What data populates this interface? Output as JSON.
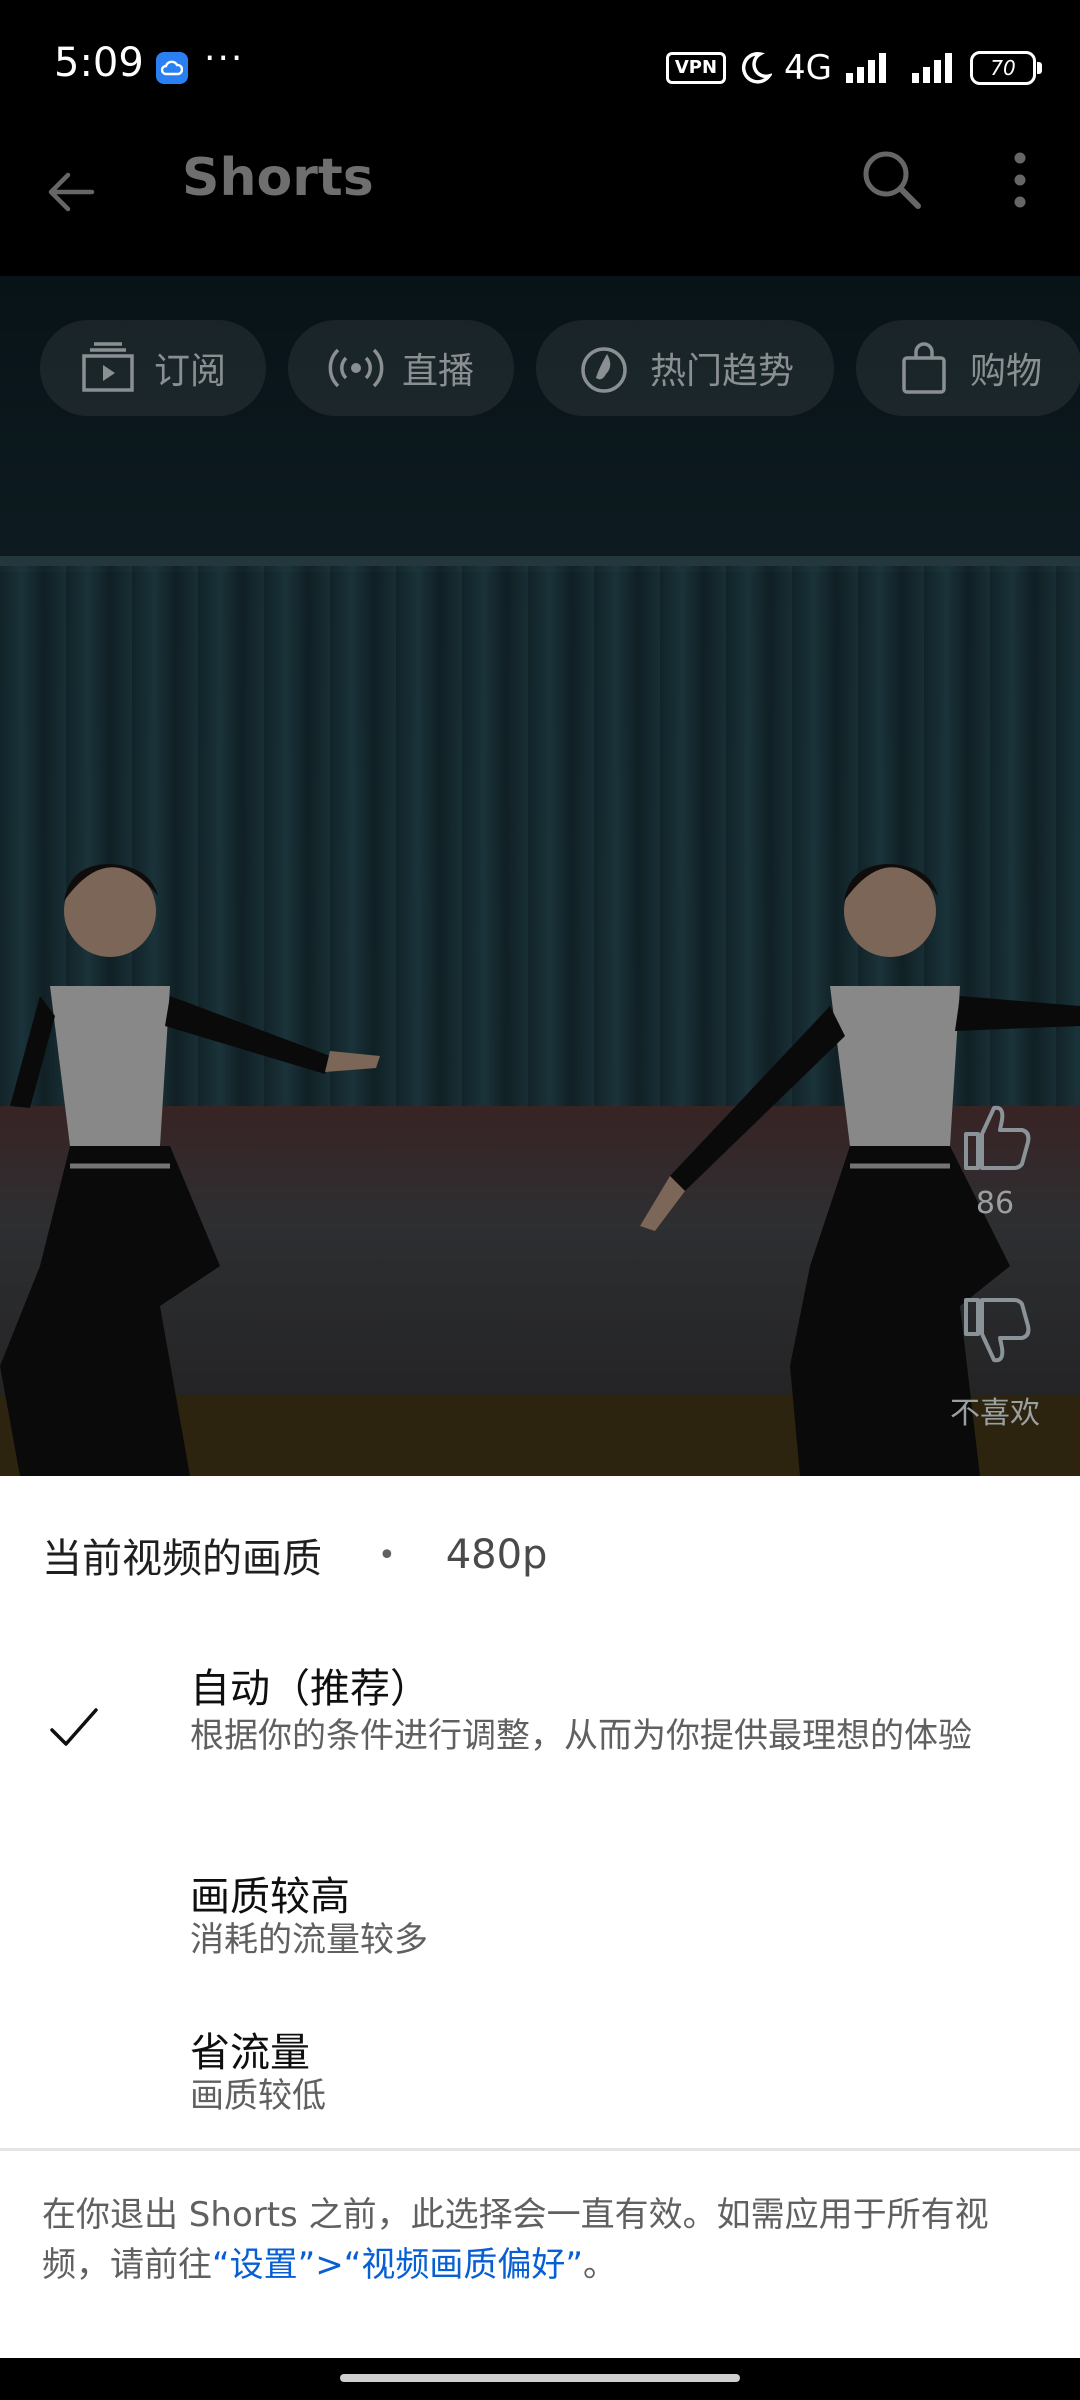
{
  "status_bar": {
    "time": "5:09",
    "dots": "···",
    "vpn": "VPN",
    "network": "4G",
    "battery": "70"
  },
  "app_bar": {
    "title": "Shorts"
  },
  "chips": [
    {
      "label": "订阅",
      "icon": "subscriptions-icon"
    },
    {
      "label": "直播",
      "icon": "live-icon"
    },
    {
      "label": "热门趋势",
      "icon": "trending-icon"
    },
    {
      "label": "购物",
      "icon": "shopping-bag-icon"
    }
  ],
  "side_actions": {
    "like_count": "86",
    "dislike_label": "不喜欢"
  },
  "quality_sheet": {
    "header_label": "当前视频的画质",
    "separator": "•",
    "current_quality": "480p",
    "options": [
      {
        "title": "自动（推荐）",
        "description": "根据你的条件进行调整，从而为你提供最理想的体验",
        "selected": true
      },
      {
        "title": "画质较高",
        "description": "消耗的流量较多",
        "selected": false
      },
      {
        "title": "省流量",
        "description": "画质较低",
        "selected": false
      }
    ],
    "footer_text": "在你退出 Shorts 之前，此选择会一直有效。如需应用于所有视频，请前往",
    "footer_link": "“设置”>“视频画质偏好”",
    "footer_end": "。"
  },
  "colors": {
    "link": "#065fd4",
    "sheet_background": "#ffffff",
    "status_cloud": "#2a7ff2"
  }
}
